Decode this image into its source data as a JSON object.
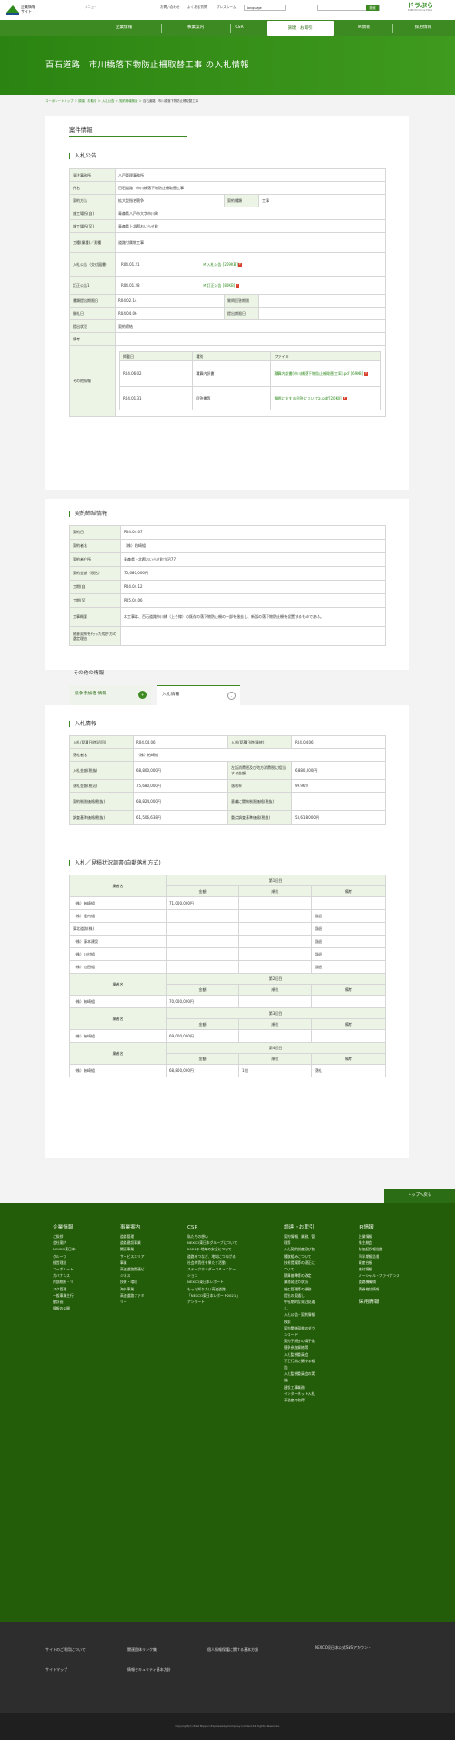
{
  "header": {
    "logo_line1": "企業情報",
    "logo_line2": "サイト",
    "menu": "メニュー",
    "util": [
      "お問い合わせ",
      "よくある質問",
      "プレスルーム"
    ],
    "language": "Language",
    "search_label": "検索",
    "dora_name": "ドラぷら",
    "dora_sub": "E-NEXCO Drive Plaza"
  },
  "nav": [
    "企業情報",
    "事業案内",
    "CSR",
    "調達・お取引",
    "IR情報",
    "採用情報"
  ],
  "hero": {
    "title": "百石道路　市川橋落下物防止柵取替工事 の入札情報"
  },
  "breadcrumb": [
    "コーポレートトップ",
    "調達・お取引",
    "入札公告",
    "契約情報検索",
    "百石道路　市川橋落下物防止柵取替工事"
  ],
  "section_title": "案件情報",
  "koukoku": {
    "heading": "入札公告",
    "rows": [
      {
        "k": "発注事務所",
        "v": "八戸管理事務所"
      },
      {
        "k": "件名",
        "v": "百石道路　市川橋落下物防止柵取替工事"
      },
      {
        "k": "契約方法",
        "v": "拡大型指名競争",
        "k2": "契約種類",
        "v2": "工事"
      },
      {
        "k": "施工場所(自)",
        "v": "青森県八戸市大字市川町"
      },
      {
        "k": "施工場所(至)",
        "v": "青森県上北郡おいらせ町"
      },
      {
        "k": "工種(業種)／業種",
        "v": "道路付属物工事"
      },
      {
        "k": "入札公告（交付図書）",
        "v": "R04.01.21",
        "link": "入札公告 [269KB]"
      },
      {
        "k": "訂正公告1",
        "v": "R04.01.28",
        "link": "訂正公告 [80KB]"
      },
      {
        "k": "書類提出期限日",
        "v": "R04.02.14",
        "k2": "質問回答期限",
        "v2": ""
      },
      {
        "k": "開札日",
        "v": "R04.04.06",
        "k2": "提出期限日",
        "v2": ""
      },
      {
        "k": "提出状況",
        "v": "契約締結"
      },
      {
        "k": "備考",
        "v": ""
      }
    ],
    "other": {
      "label": "その他情報",
      "headers": [
        "掲載日",
        "種別",
        "ファイル"
      ],
      "rows": [
        {
          "date": "R04.06.02",
          "type": "積算内訳書",
          "file": "積算内訳書[市川橋落下物防止柵取替工事].pdf [69KB]"
        },
        {
          "date": "R04.01.31",
          "type": "回答書等",
          "file": "質問に対する回答について①.pdf [20KB]"
        }
      ]
    }
  },
  "teiketsu": {
    "heading": "契約締結情報",
    "rows": [
      {
        "k": "契約日",
        "v": "R04.04.07"
      },
      {
        "k": "契約者名",
        "v": "（株）柏崎組"
      },
      {
        "k": "契約者住所",
        "v": "青森県上北郡おいらせ町立沼77"
      },
      {
        "k": "契約金額（税込）",
        "v": "75,680,000円"
      },
      {
        "k": "工期(自)",
        "v": "R04.04.12"
      },
      {
        "k": "工期(至)",
        "v": "R05.04.06"
      },
      {
        "k": "工事概要",
        "v": "本工事は、百石道路市川橋（上り線）の既存の落下物防止柵の一部を撤去し、新設の落下物防止柵を設置するものである。"
      },
      {
        "k": "随意契約を行った相手方の選定理由",
        "v": ""
      }
    ]
  },
  "sonota": {
    "heading": "その他の情報",
    "tab1": "競争参加者 情報",
    "tab1_badge": "+",
    "tab2": "入札情報",
    "tab2_badge": "-"
  },
  "nyusatsu": {
    "heading": "入札情報",
    "rows": [
      {
        "k": "入札/見積日時(初回)",
        "v": "R04.04.06",
        "k2": "入札/見積日時(最終)",
        "v2": "R04.04.06"
      },
      {
        "k": "落札者名",
        "v": "（株）柏崎組"
      },
      {
        "k": "入札金額(税抜)",
        "v": "68,800,000円",
        "k2": "左記消費税及び地方消費税に相当する金額",
        "v2": "6,880,000円"
      },
      {
        "k": "落札金額(税込)",
        "v": "75,680,000円",
        "k2": "落札率",
        "v2": "99.96%"
      },
      {
        "k": "契約制限価格(税抜)",
        "v": "68,824,000円",
        "k2": "意義に関約制限価格(税抜)",
        "v2": ""
      },
      {
        "k": "調査基準価格(税抜)",
        "v": "61,506,638円",
        "k2": "重点調査基準価格(税抜)",
        "v2": "53,618,000円"
      }
    ]
  },
  "joukyou": {
    "heading": "入札／見積状況調書(自動落札方式)",
    "col_name": "業者名",
    "col_amount": "金額",
    "col_rank": "順位",
    "col_note": "備考",
    "rounds": [
      {
        "label": "第1回目",
        "rows": [
          {
            "name": "（株）柏崎組",
            "amount": "71,000,000円",
            "rank": "",
            "note": ""
          },
          {
            "name": "（株）鹿内組",
            "amount": "",
            "rank": "",
            "note": "辞退"
          },
          {
            "name": "東北道路(株)",
            "amount": "",
            "rank": "",
            "note": "辞退"
          },
          {
            "name": "（株）藤本建設",
            "amount": "",
            "rank": "",
            "note": "辞退"
          },
          {
            "name": "（株）川村組",
            "amount": "",
            "rank": "",
            "note": "辞退"
          },
          {
            "name": "（株）山田組",
            "amount": "",
            "rank": "",
            "note": "辞退"
          }
        ]
      },
      {
        "label": "第2回目",
        "rows": [
          {
            "name": "（株）柏崎組",
            "amount": "70,000,000円",
            "rank": "",
            "note": ""
          }
        ]
      },
      {
        "label": "第3回目",
        "rows": [
          {
            "name": "（株）柏崎組",
            "amount": "69,000,000円",
            "rank": "",
            "note": ""
          }
        ]
      },
      {
        "label": "第4回目",
        "rows": [
          {
            "name": "（株）柏崎組",
            "amount": "68,800,000円",
            "rank": "1位",
            "note": "落札"
          }
        ]
      }
    ]
  },
  "footer": {
    "totop": "トップへ戻る",
    "cols": [
      {
        "title": "企業情報",
        "items": [
          "ご挨拶",
          "会社案内",
          "NEXCO東日本グループ",
          "経営理念",
          "コーポレートガバナンス",
          "内部統制・リスク管理",
          "一般事業主行動計画",
          "情報の公開"
        ]
      },
      {
        "title": "事業案内",
        "items": [
          "道路管理",
          "道路建設事業",
          "関連事業",
          "サービスエリア事業",
          "高速道路関連ビジネス",
          "技術・環境",
          "海外事業",
          "高速道路ファミリー"
        ]
      },
      {
        "title": "CSR",
        "items": [
          "私たちの想い",
          "NEXCO東日本グループについて",
          "2021年 地域の安全について",
          "道路をつなぎ、地域につなげる",
          "社会的責任を果たす活動",
          "ステークホルダーコミュニケーション",
          "NEXCO東日本レポート",
          "もっと知りたい高速道路",
          "「NEXCO東日本レポート2021」アンケート"
        ]
      },
      {
        "title": "調達・お取引",
        "items": [
          "契約情報、業務、管理等",
          "入札契約制度及び各種取組みについて",
          "技術提案等の適正について",
          "積算基準等の改定",
          "業務発注の状況",
          "施工管理等の業務",
          "提出の見通し",
          "中長期的な発注見通し",
          "入札公告・契約情報検索",
          "契約関係図書のダウンロード",
          "契約手続きの電子化",
          "競争参加資格等",
          "入札監視委員会",
          "不正行為に関する報告",
          "入札監視委員会の実施",
          "建設工事業務",
          "インターネット入札",
          "不動産の取得"
        ]
      },
      {
        "title": "IR情報",
        "items": [
          "企業情報",
          "株主総会",
          "有価証券報告書",
          "四半期報告書",
          "資産台帳",
          "格付情報",
          "ソーシャル・ファイナンス",
          "道路機構債",
          "債券格付情報"
        ]
      },
      {
        "title": "採用情報",
        "items": []
      }
    ],
    "links": [
      "サイトのご利用について",
      "関連団体リンク集",
      "個人情報保護に関する基本方針",
      "NEXCO東日本公式SNSアカウント",
      "サイトマップ",
      "情報セキュリティ基本方針"
    ],
    "copyright": "Copyright(C) East Nippon Expressway Company Limited All Rights Reserved."
  }
}
